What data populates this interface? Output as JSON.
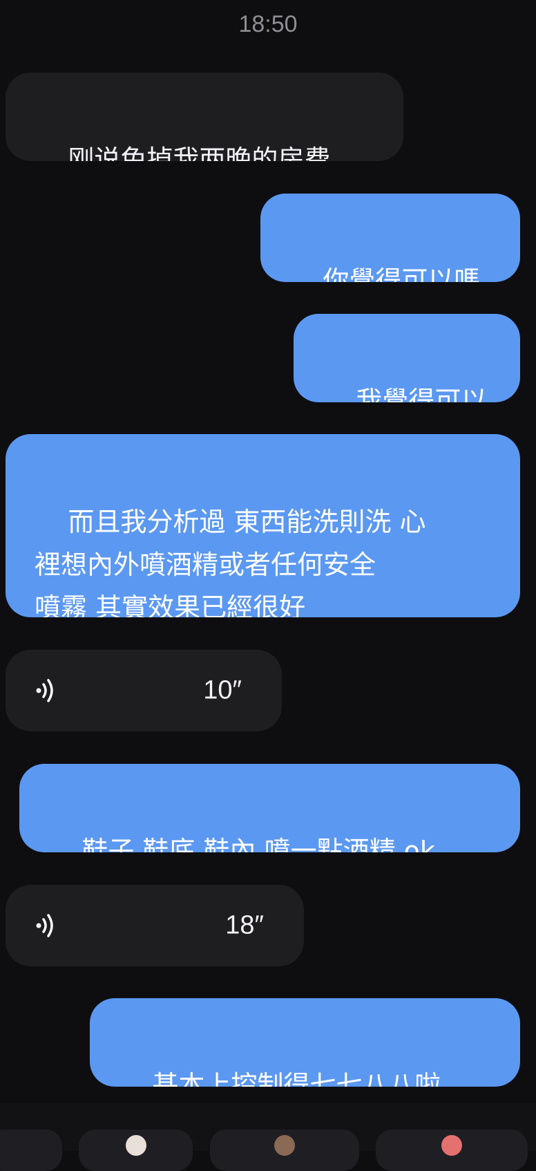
{
  "chat": {
    "timestamp": "18:50",
    "messages": [
      {
        "id": "m1",
        "direction": "incoming",
        "type": "text",
        "text": "刚说免掉我两晚的房费"
      },
      {
        "id": "m2",
        "direction": "outgoing",
        "type": "text",
        "text": "你覺得可以嗎"
      },
      {
        "id": "m3",
        "direction": "outgoing",
        "type": "text",
        "text": "我覺得可以"
      },
      {
        "id": "m4",
        "direction": "outgoing",
        "type": "text",
        "text": "而且我分析過 東西能洗則洗 心\n裡想內外噴酒精或者任何安全\n噴霧 其實效果已經很好"
      },
      {
        "id": "m5",
        "direction": "incoming",
        "type": "voice",
        "duration": "10″",
        "icon": "voice-wave-icon"
      },
      {
        "id": "m6",
        "direction": "outgoing",
        "type": "text",
        "text": "鞋子 鞋底 鞋內 噴一點酒精 ok"
      },
      {
        "id": "m7",
        "direction": "incoming",
        "type": "voice",
        "duration": "18″",
        "icon": "voice-wave-icon"
      },
      {
        "id": "m8",
        "direction": "outgoing",
        "type": "text",
        "text": "基本上控制得七七八八啦"
      }
    ]
  },
  "sticker_tray": {
    "items": [
      "sticker-1",
      "sticker-2",
      "sticker-3",
      "sticker-4"
    ]
  },
  "colors": {
    "background": "#0e0e11",
    "incoming_bubble": "#1e1e21",
    "outgoing_bubble": "#5b98f1",
    "timestamp": "#8e8e93"
  }
}
